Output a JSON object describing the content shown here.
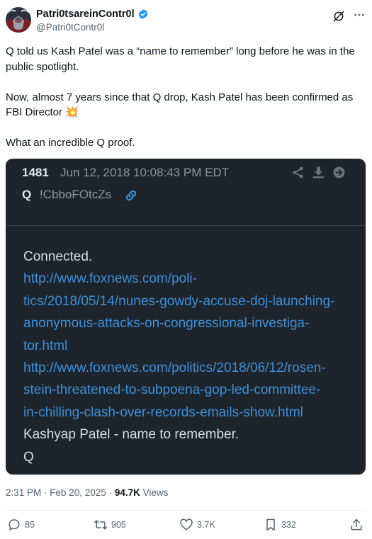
{
  "author": {
    "display_name": "Patri0tsareinContr0l",
    "handle": "@Patri0tContr0l",
    "verified": true,
    "avatar": "warrior-avatar-icon"
  },
  "tweet": {
    "paragraphs": [
      "Q told us Kash Patel was a “name to remember” long before he was in the public spotlight.",
      "Now, almost 7 years since that Q drop, Kash Patel has been confirmed as FBI Director 💥",
      "What an incredible Q proof."
    ]
  },
  "qdrop": {
    "number": "1481",
    "date": "Jun 12, 2018 10:08:43 PM EDT",
    "author": "Q",
    "tripcode": "!CbboFOtcZs",
    "lines": {
      "l1": "Connected.",
      "l2": "http://www.foxnews.com/poli-",
      "l3": "tics/2018/05/14/nunes-gowdy-accuse-doj-launching-",
      "l4": "anonymous-attacks-on-congressional-investiga-",
      "l5": "tor.html",
      "l6": "http://www.foxnews.com/politics/2018/06/12/rosen-",
      "l7": "stein-threatened-to-subpoena-gop-led-committee-",
      "l8": "in-chilling-clash-over-records-emails-show.html",
      "l9": "Kashyap Patel - name to remember.",
      "l10": "Q"
    },
    "colors": {
      "background": "#1e242b",
      "link": "#3b8fd9",
      "text": "#d9dde0"
    }
  },
  "meta": {
    "time": "2:31 PM",
    "date": "Feb 20, 2025",
    "views_count": "94.7K",
    "views_label": "Views"
  },
  "actions": {
    "replies": "85",
    "reposts": "905",
    "likes": "3.7K",
    "bookmarks": "332"
  },
  "colors": {
    "verified": "#1d9bf0",
    "secondary_text": "#536471"
  }
}
